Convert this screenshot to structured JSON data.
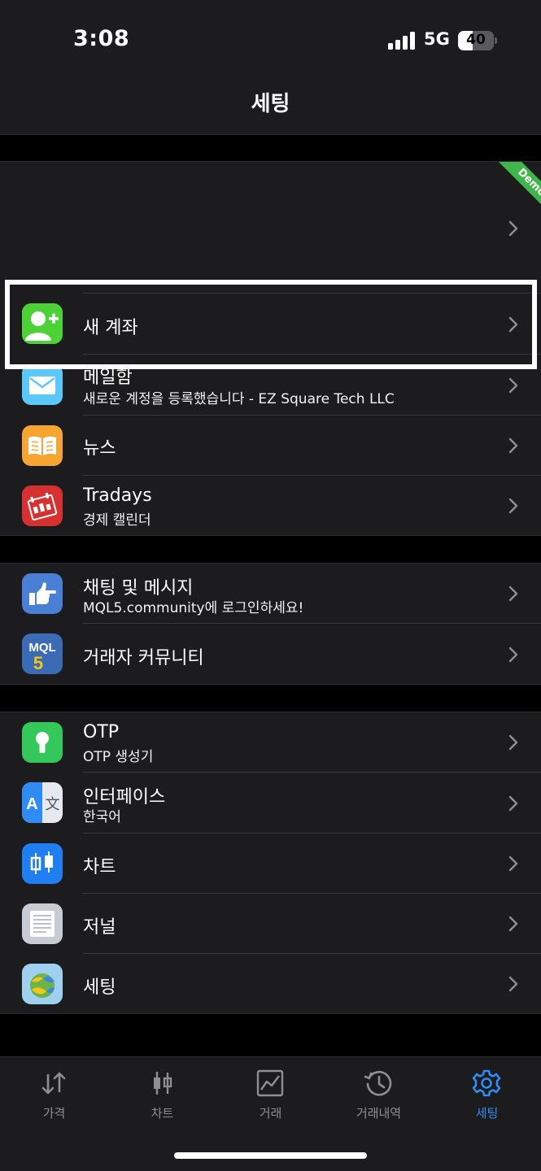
{
  "status_bar": {
    "time": "3:08",
    "network": "5G",
    "battery": "40",
    "battery_level_percent": 40
  },
  "nav_bar": {
    "title": "세팅"
  },
  "account": {
    "badge": "Demo"
  },
  "groups": [
    {
      "items": [
        {
          "title": "새 계좌",
          "subtitle": "",
          "icon": "add-user-icon",
          "color": "#4cd137"
        },
        {
          "title": "메일함",
          "subtitle": "새로운 계정을 등록했습니다 - EZ Square Tech LLC",
          "icon": "mail-icon",
          "color": "#5ac8fa"
        },
        {
          "title": "뉴스",
          "subtitle": "",
          "icon": "book-icon",
          "color": "#f7a531"
        },
        {
          "title": "Tradays",
          "subtitle": "경제 캘린더",
          "icon": "calendar-icon",
          "color": "#d63031"
        }
      ]
    },
    {
      "items": [
        {
          "title": "채팅 및 메시지",
          "subtitle": "MQL5.community에 로그인하세요!",
          "icon": "thumb-pointing-icon",
          "color": "#4a7fd6"
        },
        {
          "title": "거래자 커뮤니티",
          "subtitle": "",
          "icon": "mql5-logo-icon",
          "color": "#3c6bb5",
          "logo_text": "MQL",
          "logo_num": "5"
        }
      ]
    },
    {
      "items": [
        {
          "title": "OTP",
          "subtitle": "OTP 생성기",
          "icon": "keyhole-icon",
          "color": "#34c759"
        },
        {
          "title": "인터페이스",
          "subtitle": "한국어",
          "icon": "translate-icon",
          "color": "#2f8cf5",
          "glyph_a": "A",
          "glyph_b": "文"
        },
        {
          "title": "차트",
          "subtitle": "",
          "icon": "candlestick-icon",
          "color": "#1f7ef2"
        },
        {
          "title": "저널",
          "subtitle": "",
          "icon": "journal-icon",
          "color": "#c7cbd4"
        },
        {
          "title": "세팅",
          "subtitle": "",
          "icon": "metatrader-logo-icon",
          "color": "#9fd0f0"
        }
      ]
    }
  ],
  "tab_bar": {
    "tabs": [
      {
        "label": "가격",
        "icon": "arrows-updown-icon",
        "active": false
      },
      {
        "label": "차트",
        "icon": "candlestick-icon",
        "active": false
      },
      {
        "label": "거래",
        "icon": "trade-chart-icon",
        "active": false
      },
      {
        "label": "거래내역",
        "icon": "history-icon",
        "active": false
      },
      {
        "label": "세팅",
        "icon": "gear-icon",
        "active": true
      }
    ],
    "active_color": "#2f8cf5",
    "inactive_color": "#8e8e93"
  }
}
